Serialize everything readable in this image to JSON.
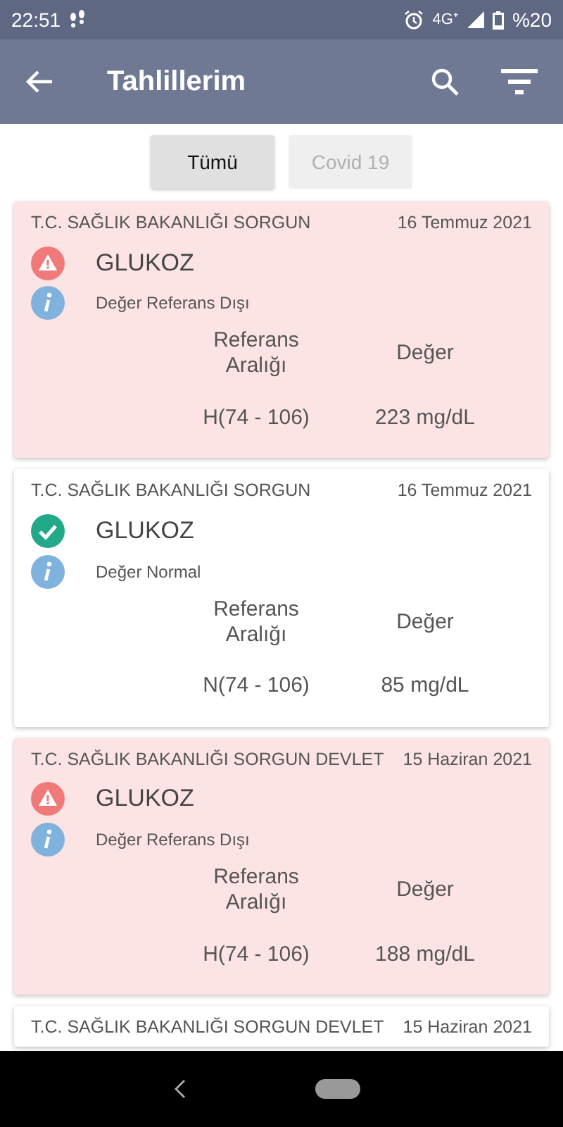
{
  "status_bar": {
    "time": "22:51",
    "network": "4G⁺",
    "battery": "%20"
  },
  "app_bar": {
    "title": "Tahlillerim"
  },
  "tabs": [
    {
      "label": "Tümü",
      "selected": true
    },
    {
      "label": "Covid 19",
      "selected": false
    }
  ],
  "results": [
    {
      "kind": "abnormal",
      "hospital": "T.C. SAĞLIK BAKANLIĞI SORGUN",
      "date": "16 Temmuz 2021",
      "test": "GLUKOZ",
      "status": "Değer Referans Dışı",
      "range_label": "Referans Aralığı",
      "value_label": "Değer",
      "range": "H(74 - 106)",
      "value": "223 mg/dL"
    },
    {
      "kind": "normal",
      "hospital": "T.C. SAĞLIK BAKANLIĞI SORGUN",
      "date": "16 Temmuz 2021",
      "test": "GLUKOZ",
      "status": "Değer Normal",
      "range_label": "Referans Aralığı",
      "value_label": "Değer",
      "range": "N(74 - 106)",
      "value": "85 mg/dL"
    },
    {
      "kind": "abnormal",
      "hospital": "T.C. SAĞLIK BAKANLIĞI SORGUN DEVLET",
      "date": "15 Haziran 2021",
      "test": "GLUKOZ",
      "status": "Değer Referans Dışı",
      "range_label": "Referans Aralığı",
      "value_label": "Değer",
      "range": "H(74 - 106)",
      "value": "188 mg/dL"
    },
    {
      "kind": "normal",
      "hospital": "T.C. SAĞLIK BAKANLIĞI SORGUN DEVLET",
      "date": "15 Haziran 2021"
    }
  ]
}
